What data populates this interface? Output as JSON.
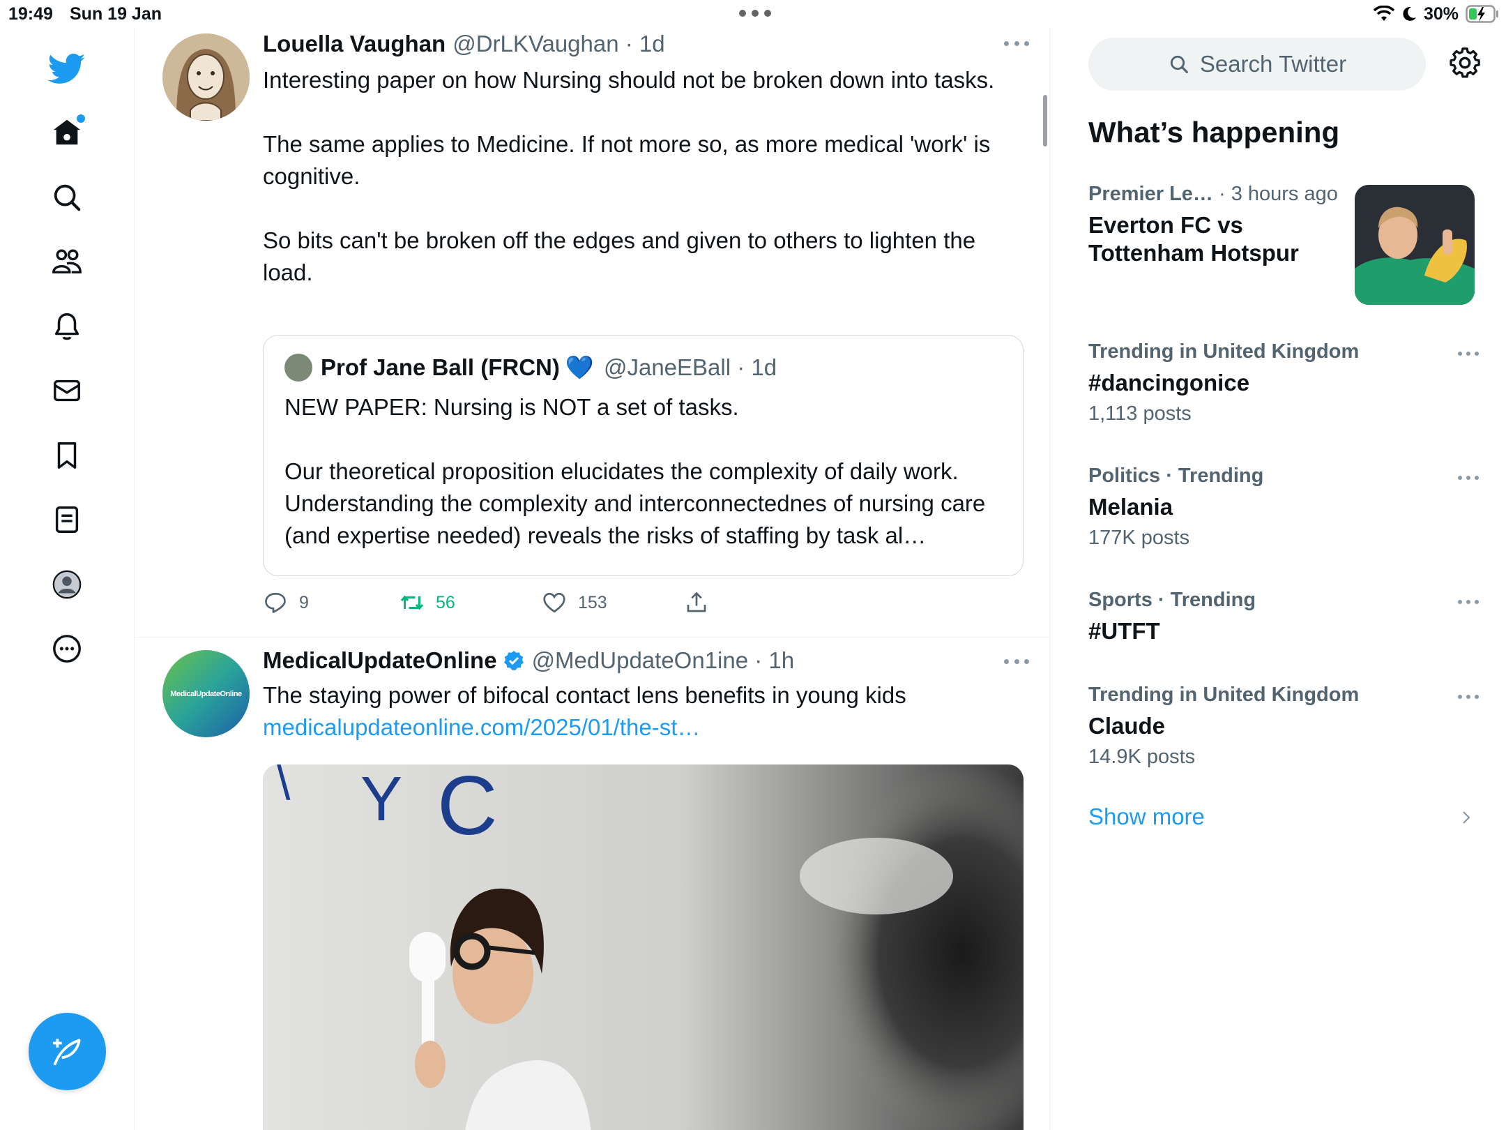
{
  "status_bar": {
    "time": "19:49",
    "date": "Sun 19 Jan",
    "battery": "30%"
  },
  "nav": {
    "items": [
      "twitter-logo",
      "home",
      "search",
      "communities",
      "notifications",
      "messages",
      "bookmarks",
      "lists",
      "profile",
      "more"
    ],
    "home_badge": true
  },
  "tweets": [
    {
      "name": "Louella Vaughan",
      "handle": "@DrLKVaughan · 1d",
      "paragraphs": [
        "Interesting paper on how Nursing should not be broken down into tasks.",
        "The same applies to Medicine. If not more so, as more medical 'work' is cognitive.",
        "So bits can't be broken off the edges and given to others to lighten the load."
      ],
      "quote": {
        "name": "Prof Jane Ball (FRCN)",
        "emoji": "💙",
        "handle": "@JaneEBall · 1d",
        "paragraphs": [
          "NEW PAPER: Nursing is NOT a set of tasks.",
          "Our theoretical proposition elucidates the complexity of daily work. Understanding the complexity and interconnectednes of nursing care (and expertise needed) reveals the risks of staffing by task al…"
        ]
      },
      "actions": {
        "replies": "9",
        "retweets": "56",
        "likes": "153"
      }
    },
    {
      "name": "MedicalUpdateOnline",
      "handle": "@MedUpdateOn1ine · 1h",
      "avatar_text": "MedicalUpdateOnline",
      "text": "The staying power of bifocal contact lens benefits in young kids",
      "link": "medicalupdateonline.com/2025/01/the-st…"
    }
  ],
  "sidebar": {
    "search_placeholder": "Search Twitter",
    "section_title": "What’s happening",
    "trends": [
      {
        "meta_a": "Premier Le…",
        "meta_b": " · 3 hours ago",
        "topic": "Everton FC vs Tottenham Hotspur",
        "count": ""
      },
      {
        "meta_a": "Trending in United Kingdom",
        "meta_b": "",
        "topic": "#dancingonice",
        "count": "1,113 posts"
      },
      {
        "meta_a": "Politics · Trending",
        "meta_b": "",
        "topic": "Melania",
        "count": "177K posts"
      },
      {
        "meta_a": "Sports · Trending",
        "meta_b": "",
        "topic": "#UTFT",
        "count": ""
      },
      {
        "meta_a": "Trending in United Kingdom",
        "meta_b": "",
        "topic": "Claude",
        "count": "14.9K posts"
      }
    ],
    "show_more": "Show more"
  },
  "colors": {
    "accent": "#1d9bf0",
    "retweet_green": "#00ba7c",
    "secondary_text": "#536471"
  }
}
